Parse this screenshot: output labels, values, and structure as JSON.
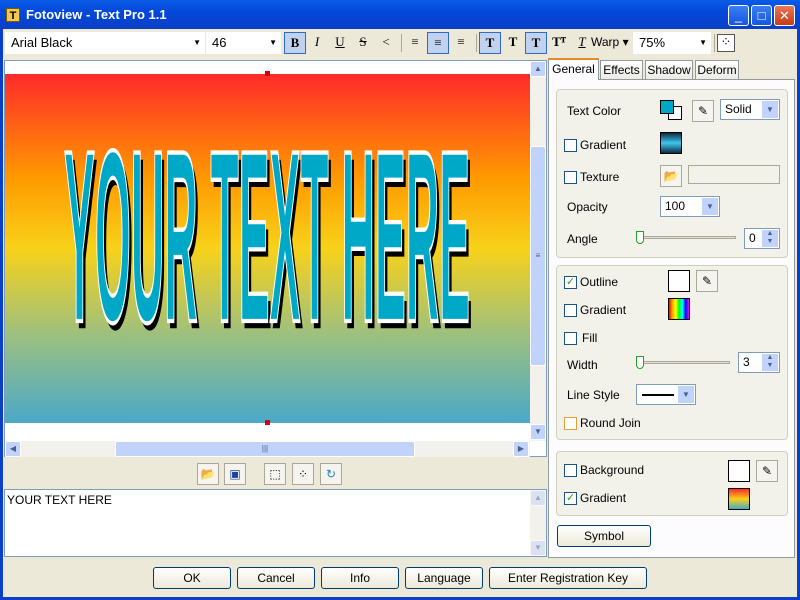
{
  "window": {
    "title": "Fotoview - Text Pro 1.1",
    "icon": "text-t-icon"
  },
  "toolbar": {
    "font": "Arial Black",
    "size": "46",
    "bold": "B",
    "italic": "I",
    "underline": "U",
    "strike": "S",
    "warp": "Warp",
    "zoom": "75%",
    "active": [
      "bold",
      "align-center",
      "text-style-1",
      "text-style-3"
    ]
  },
  "canvas": {
    "text": "YOUR TEXT HERE",
    "background_gradient": [
      "#ff2a2a",
      "#ffa000",
      "#f8d21a",
      "#6ab8b0",
      "#4aa8c8"
    ],
    "text_color": "#00a8c8",
    "outline_color": "#ffffff",
    "shadow_color": "#000000"
  },
  "editor": {
    "value": "YOUR TEXT HERE"
  },
  "tabs": [
    {
      "label": "General",
      "active": true
    },
    {
      "label": "Effects"
    },
    {
      "label": "Shadow"
    },
    {
      "label": "Deform"
    }
  ],
  "general": {
    "text_color_label": "Text Color",
    "text_color": "#00a8c8",
    "fill_mode": "Solid",
    "gradient_label": "Gradient",
    "gradient_checked": false,
    "texture_label": "Texture",
    "texture_checked": false,
    "texture_path": "",
    "opacity_label": "Opacity",
    "opacity": "100",
    "angle_label": "Angle",
    "angle": "0",
    "outline_label": "Outline",
    "outline_checked": true,
    "outline_gradient_label": "Gradient",
    "outline_gradient_checked": false,
    "fill_label": "Fill",
    "fill_checked": false,
    "width_label": "Width",
    "width": "3",
    "line_style_label": "Line Style",
    "round_join_label": "Round Join",
    "round_join_checked": false,
    "background_label": "Background",
    "background_checked": false,
    "bg_gradient_label": "Gradient",
    "bg_gradient_checked": true,
    "symbol_label": "Symbol"
  },
  "buttons": {
    "ok": "OK",
    "cancel": "Cancel",
    "info": "Info",
    "language": "Language",
    "register": "Enter Registration Key"
  }
}
